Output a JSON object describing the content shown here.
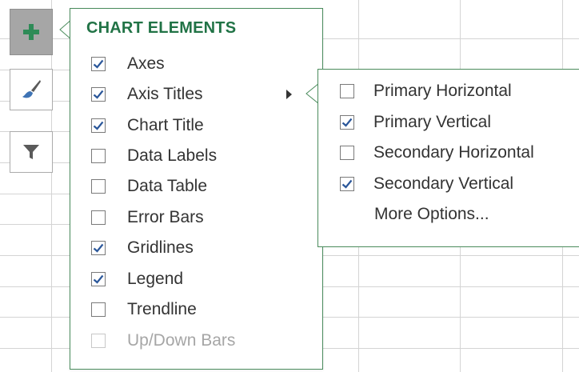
{
  "popup": {
    "title": "CHART ELEMENTS",
    "items": [
      {
        "label": "Axes",
        "checked": true
      },
      {
        "label": "Axis Titles",
        "checked": true
      },
      {
        "label": "Chart Title",
        "checked": true
      },
      {
        "label": "Data Labels",
        "checked": false
      },
      {
        "label": "Data Table",
        "checked": false
      },
      {
        "label": "Error Bars",
        "checked": false
      },
      {
        "label": "Gridlines",
        "checked": true
      },
      {
        "label": "Legend",
        "checked": true
      },
      {
        "label": "Trendline",
        "checked": false
      },
      {
        "label": "Up/Down Bars",
        "checked": false,
        "disabled": true
      }
    ]
  },
  "submenu": {
    "items": [
      {
        "label": "Primary Horizontal",
        "checked": false
      },
      {
        "label": "Primary Vertical",
        "checked": true
      },
      {
        "label": "Secondary Horizontal",
        "checked": false
      },
      {
        "label": "Secondary Vertical",
        "checked": true
      }
    ],
    "more_options": "More Options..."
  },
  "side_buttons": {
    "chart_elements_icon": "plus-icon",
    "chart_styles_icon": "paintbrush-icon",
    "chart_filters_icon": "filter-icon"
  },
  "colors": {
    "accent": "#217346",
    "popup_border": "#4a8b5c",
    "check": "#2b579a",
    "grid": "#d4d4d4"
  }
}
